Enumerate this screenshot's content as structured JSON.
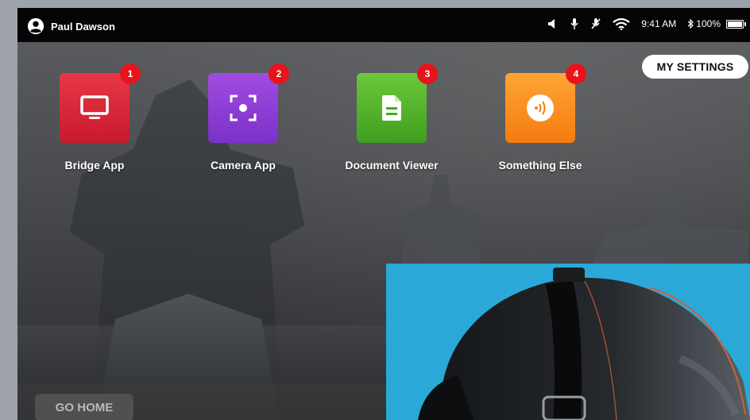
{
  "status_bar": {
    "user_name": "Paul Dawson",
    "time": "9:41 AM",
    "battery": "100%",
    "icons": [
      "account-circle-icon",
      "speaker-icon",
      "microphone-icon",
      "microphone-off-icon",
      "wifi-icon",
      "bluetooth-icon",
      "battery-icon"
    ]
  },
  "settings_button": {
    "label": "MY SETTINGS"
  },
  "apps": [
    {
      "label": "Bridge App",
      "badge": "1",
      "icon": "monitor-icon",
      "color": "#d6273a"
    },
    {
      "label": "Camera App",
      "badge": "2",
      "icon": "camera-focus-icon",
      "color": "#8e3fd6"
    },
    {
      "label": "Document Viewer",
      "badge": "3",
      "icon": "document-icon",
      "color": "#56b52d"
    },
    {
      "label": "Something Else",
      "badge": "4",
      "icon": "signal-waves-icon",
      "color": "#f58d1f"
    }
  ],
  "go_home": {
    "label": "GO HOME"
  },
  "colors": {
    "status_bar": "#050505",
    "badge": "#e8131b",
    "overlay_panel": "#2aa9d9"
  }
}
